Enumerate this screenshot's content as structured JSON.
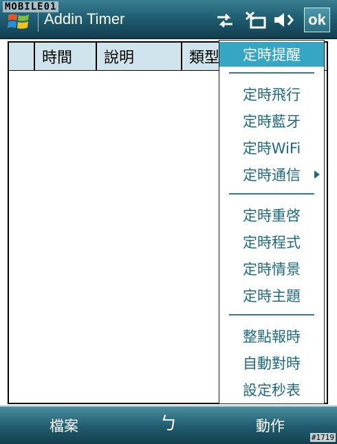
{
  "watermark": "MOBILE01",
  "corner_tag": "#1719",
  "titlebar": {
    "title": "Addin Timer",
    "ok_label": "ok"
  },
  "table": {
    "columns": [
      "時間",
      "說明",
      "類型"
    ]
  },
  "menu": {
    "group1": [
      "定時提醒"
    ],
    "group2": [
      "定時飛行",
      "定時藍牙",
      "定時WiFi",
      "定時通信"
    ],
    "group3": [
      "定時重啓",
      "定時程式",
      "定時情景",
      "定時主題"
    ],
    "group4": [
      "整點報時",
      "自動對時",
      "設定秒表"
    ]
  },
  "softkeys": {
    "left": "檔案",
    "center": "ㄅ",
    "right": "動作"
  },
  "colors": {
    "accent": "#35a6c3",
    "menu_text": "#1e6a80",
    "header_bg": "#cfe4ec"
  }
}
